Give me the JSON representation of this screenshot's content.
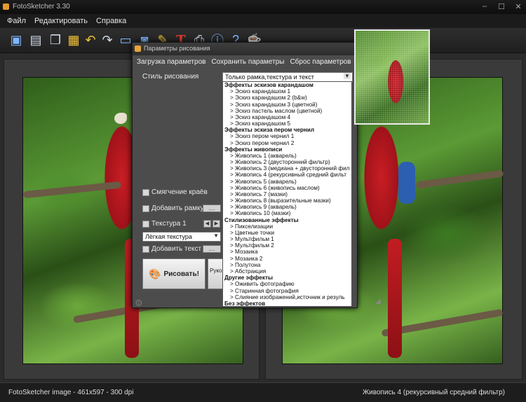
{
  "window": {
    "title": "FotoSketcher 3.30",
    "controls": [
      "–",
      "☐",
      "✕"
    ]
  },
  "menu": [
    "Файл",
    "Редактировать",
    "Справка"
  ],
  "toolbar": {
    "icons": [
      "open-image-icon",
      "save-icon",
      "copy-icon",
      "paste-icon",
      "undo-icon",
      "redo-icon",
      "image-icon",
      "frame-icon",
      "palette-icon",
      "text-tool-icon",
      "print-icon",
      "info-icon",
      "help-icon",
      "coffee-icon",
      "zoom-in-icon",
      "zoom-out-icon",
      "zoom-fit-icon"
    ]
  },
  "dialog": {
    "title": "Параметры рисования",
    "menu": [
      "Загрузка параметров",
      "Сохранить параметры",
      "Сброс параметров"
    ],
    "style_label": "Стиль рисования",
    "style_value": "Только рамка,текстура и текст",
    "options": {
      "smooth_edges": "Смягчение краёв",
      "add_frame": "Добавить рамку",
      "texture": "Текстура 1",
      "texture_value": "Лёгкая текстура",
      "add_text": "Добавить текст",
      "dots": "...."
    },
    "draw_button": "Рисовать!",
    "guide_button": "Руководство"
  },
  "dropdown": [
    {
      "type": "h",
      "text": "Эффекты эскизов карандашом"
    },
    {
      "type": "i",
      "text": ">  Эскиз карандашом 1"
    },
    {
      "type": "i",
      "text": ">  Эскиз карандашом 2 (b&w)"
    },
    {
      "type": "i",
      "text": ">  Эскиз карандашом 3 (цветной)"
    },
    {
      "type": "i",
      "text": ">  Эскиз пастель маслом (цветной)"
    },
    {
      "type": "i",
      "text": ">  Эскиз карандашом 4"
    },
    {
      "type": "i",
      "text": ">  Эскиз карандашом 5"
    },
    {
      "type": "h",
      "text": "Эффекты эскиза пером чернил"
    },
    {
      "type": "i",
      "text": ">  Эскиз пером чернил 1"
    },
    {
      "type": "i",
      "text": ">  Эскиз пером чернил 2"
    },
    {
      "type": "h",
      "text": "Эффекты живописи"
    },
    {
      "type": "i",
      "text": ">  Живопись 1 (акварель)"
    },
    {
      "type": "i",
      "text": ">  Живопись 2 (двусторонний фильтр)"
    },
    {
      "type": "i",
      "text": ">  Живопись 3 (медиана + двусторонний фил"
    },
    {
      "type": "i",
      "text": ">  Живопись 4 (рекурсивный средний фильт"
    },
    {
      "type": "i",
      "text": ">  Живопись 5 (акварель)"
    },
    {
      "type": "i",
      "text": ">  Живопись 6 (живопись маслом)"
    },
    {
      "type": "i",
      "text": ">  Живопись 7 (мазки)"
    },
    {
      "type": "i",
      "text": ">  Живопись 8 (выразительные мазки)"
    },
    {
      "type": "i",
      "text": ">  Живопись 9 (акварель)"
    },
    {
      "type": "i",
      "text": ">  Живопись 10 (мазки)"
    },
    {
      "type": "h",
      "text": "Стилизованные эффекты"
    },
    {
      "type": "i",
      "text": ">  Пикселизации"
    },
    {
      "type": "i",
      "text": ">  Цветные точки"
    },
    {
      "type": "i",
      "text": ">  Мультфильм 1"
    },
    {
      "type": "i",
      "text": ">  Мультфильм 2"
    },
    {
      "type": "i",
      "text": ">  Мозаика"
    },
    {
      "type": "i",
      "text": ">  Мозаика 2"
    },
    {
      "type": "i",
      "text": ">  Полутона"
    },
    {
      "type": "i",
      "text": ">  Абстракция"
    },
    {
      "type": "h",
      "text": "Другие эффекты"
    },
    {
      "type": "i",
      "text": ">  Оживить фотографию"
    },
    {
      "type": "i",
      "text": ">  Старинная фотография"
    },
    {
      "type": "i",
      "text": ">  Слияние изображений,источник и резуль"
    },
    {
      "type": "h",
      "text": "Без эффектов"
    },
    {
      "type": "sel",
      "text": ">  Только рамка,текстура и текст"
    }
  ],
  "status": {
    "left": "FotoSketcher image - 461x597 - 300 dpi",
    "right": "Живопись 4 (рекурсивный средний фильтр)"
  }
}
